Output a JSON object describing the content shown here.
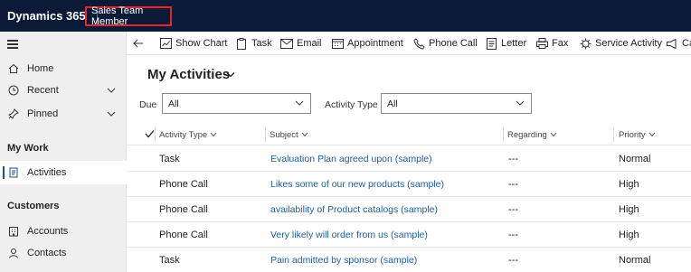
{
  "app": {
    "title": "Dynamics 365",
    "badge": "Sales Team Member"
  },
  "sidebar": {
    "top_items": [
      {
        "label": "Home",
        "icon": "home-icon"
      },
      {
        "label": "Recent",
        "icon": "clock-icon"
      },
      {
        "label": "Pinned",
        "icon": "pin-icon"
      }
    ],
    "groups": [
      {
        "title": "My Work",
        "items": [
          {
            "label": "Activities",
            "icon": "activities-icon",
            "active": true
          }
        ]
      },
      {
        "title": "Customers",
        "items": [
          {
            "label": "Accounts",
            "icon": "accounts-icon"
          },
          {
            "label": "Contacts",
            "icon": "contacts-icon"
          }
        ]
      }
    ]
  },
  "command_bar": {
    "items": [
      "Show Chart",
      "Task",
      "Email",
      "Appointment",
      "Phone Call",
      "Letter",
      "Fax",
      "Service Activity",
      "Ca"
    ]
  },
  "view": {
    "title": "My Activities"
  },
  "filters": {
    "due_label": "Due",
    "due_value": "All",
    "type_label": "Activity Type",
    "type_value": "All"
  },
  "grid": {
    "columns": [
      "Activity Type",
      "Subject",
      "Regarding",
      "Priority"
    ],
    "rows": [
      {
        "type": "Task",
        "subject": "Evaluation Plan agreed upon (sample)",
        "regarding": "---",
        "priority": "Normal"
      },
      {
        "type": "Phone Call",
        "subject": "Likes some of our new products (sample)",
        "regarding": "---",
        "priority": "High"
      },
      {
        "type": "Phone Call",
        "subject": "availability of Product catalogs (sample)",
        "regarding": "---",
        "priority": "High"
      },
      {
        "type": "Phone Call",
        "subject": "Very likely will order from us (sample)",
        "regarding": "---",
        "priority": "High"
      },
      {
        "type": "Task",
        "subject": "Pain admitted by sponsor (sample)",
        "regarding": "---",
        "priority": "Normal"
      }
    ]
  },
  "colors": {
    "topbar": "#0b1a36",
    "highlight": "#e8232d",
    "link": "#1b5da8",
    "active_bar": "#1a4f9c"
  }
}
